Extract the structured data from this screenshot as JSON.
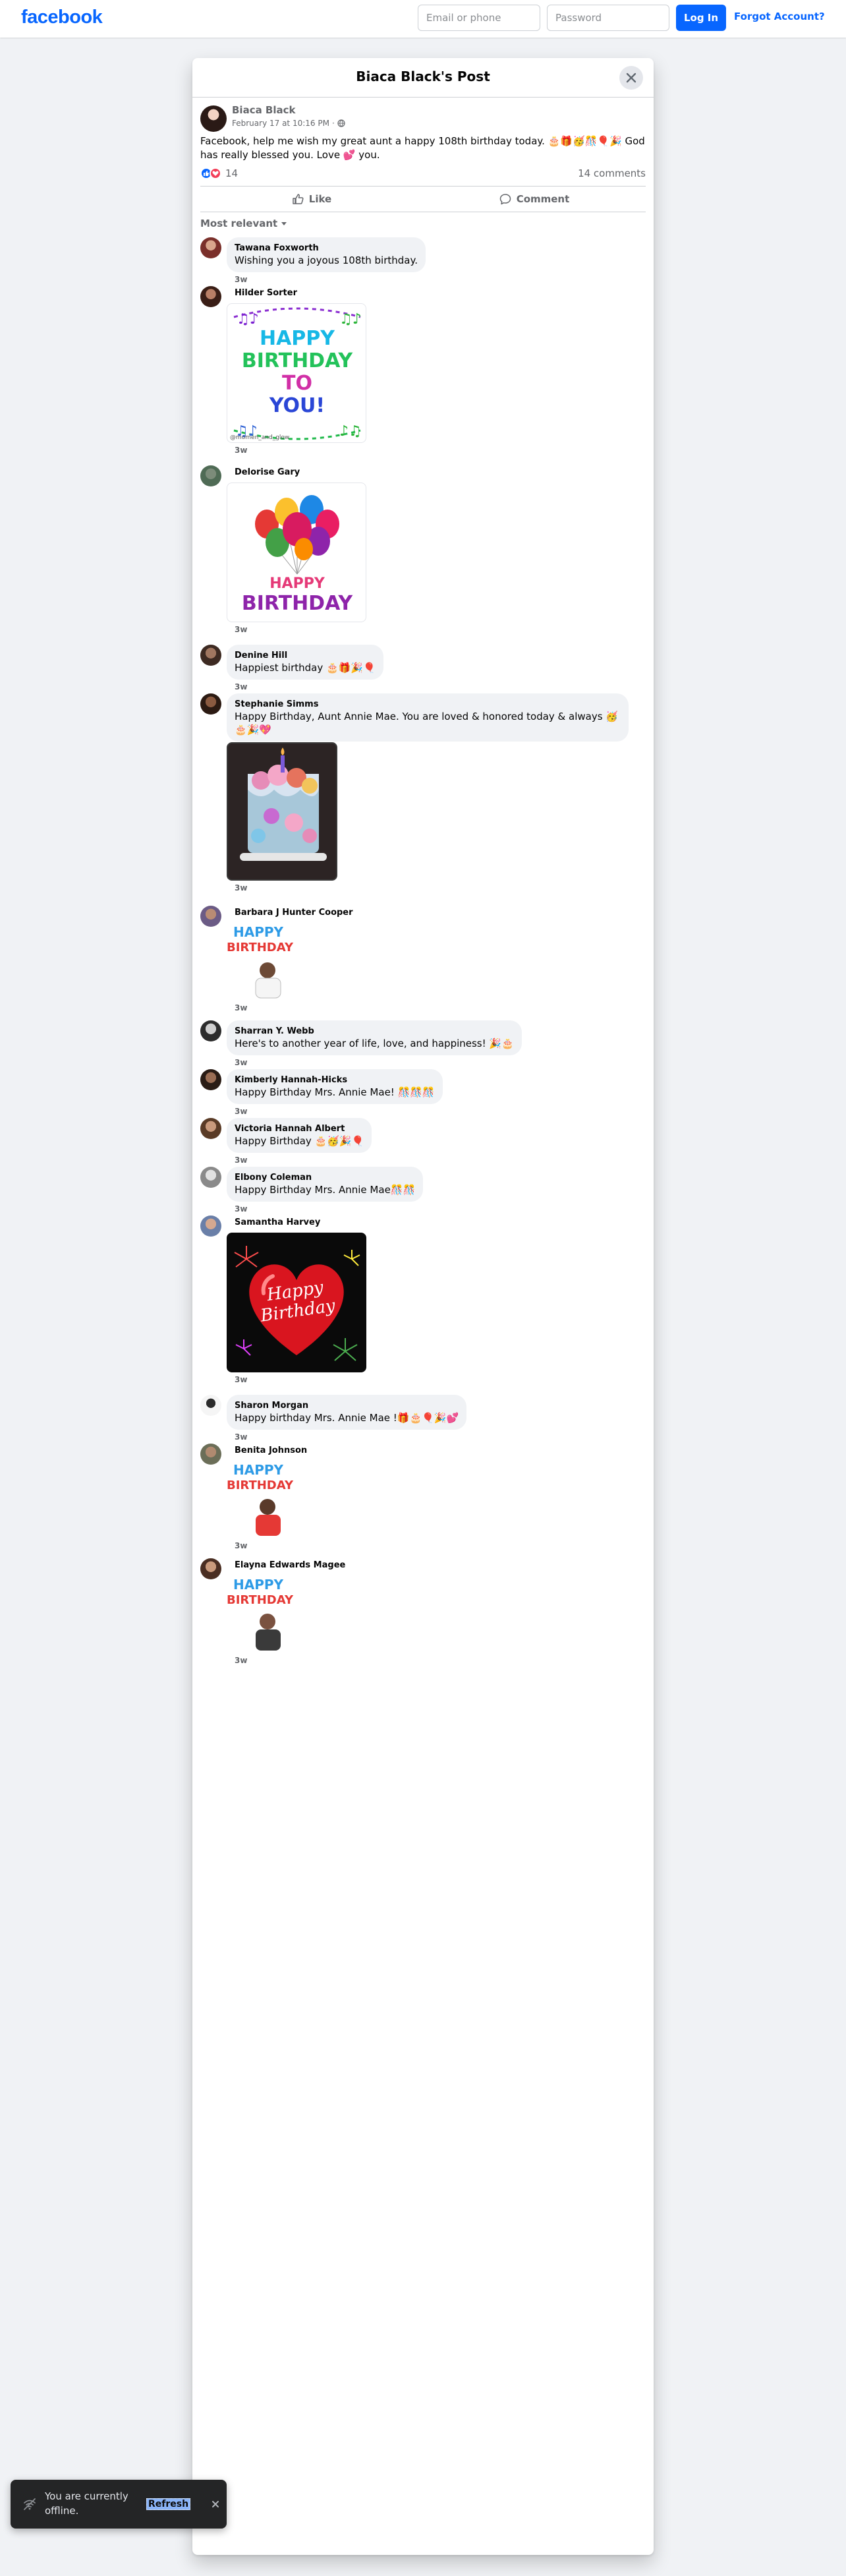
{
  "topbar": {
    "logo": "facebook",
    "email_placeholder": "Email or phone",
    "password_placeholder": "Password",
    "login_label": "Log In",
    "forgot_label": "Forgot Account?"
  },
  "dialog": {
    "title": "Biaca Black's Post",
    "post": {
      "author": "Biaca Black",
      "date": "February 17 at 10:16 PM",
      "separator": "·",
      "text": "Facebook, help me wish my great aunt a happy 108th birthday today. 🎂🎁🥳🎊🎈🎉 God has really blessed you. Love 💕 you.",
      "reaction_count": "14",
      "comments_count": "14 comments"
    },
    "actions": {
      "like": "Like",
      "comment": "Comment"
    },
    "sort_label": "Most relevant",
    "comments": [
      {
        "name": "Tawana Foxworth",
        "text": "Wishing you a joyous 108th birthday.",
        "time": "3w"
      },
      {
        "name": "Hilder Sorter",
        "time": "3w",
        "media_lines": [
          "HAPPY",
          "BIRTHDAY",
          "TO",
          "YOU!"
        ],
        "watermark": "@momen_and_glow"
      },
      {
        "name": "Delorise Gary",
        "time": "3w",
        "media_lines": [
          "HAPPY",
          "BIRTHDAY"
        ]
      },
      {
        "name": "Denine Hill",
        "text": "Happiest birthday 🎂🎁🎉🎈",
        "time": "3w"
      },
      {
        "name": "Stephanie Simms",
        "text": "Happy Birthday, Aunt Annie Mae. You are loved & honored today & always 🥳🎂🎉💖",
        "time": "3w"
      },
      {
        "name": "Barbara J Hunter Cooper",
        "time": "3w",
        "media_lines": [
          "HAPPY",
          "BIRTHDAY"
        ]
      },
      {
        "name": "Sharran Y. Webb",
        "text": "Here's to another year of life, love, and happiness! 🎉🎂",
        "time": "3w"
      },
      {
        "name": "Kimberly Hannah-Hicks",
        "text": "Happy Birthday Mrs. Annie Mae! 🎊🎊🎊",
        "time": "3w"
      },
      {
        "name": "Victoria Hannah Albert",
        "text": "Happy Birthday 🎂🥳🎉🎈",
        "time": "3w"
      },
      {
        "name": "Elbony Coleman",
        "text": "Happy Birthday Mrs. Annie Mae🎊🎊",
        "time": "3w"
      },
      {
        "name": "Samantha Harvey",
        "time": "3w",
        "media_lines": [
          "Happy",
          "Birthday"
        ]
      },
      {
        "name": "Sharon Morgan",
        "text": "Happy birthday Mrs. Annie Mae !🎁🎂🎈🎉💕",
        "time": "3w"
      },
      {
        "name": "Benita Johnson",
        "time": "3w",
        "media_lines": [
          "HAPPY",
          "BIRTHDAY"
        ]
      },
      {
        "name": "Elayna Edwards Magee",
        "time": "3w",
        "media_lines": [
          "HAPPY",
          "BIRTHDAY"
        ]
      }
    ]
  },
  "toast": {
    "text": "You are currently offline.",
    "refresh_label": "Refresh"
  },
  "colors": {
    "brand": "#0866ff",
    "bubble": "#f0f2f5",
    "muted": "#65676b"
  },
  "icons": [
    "close-icon",
    "globe-icon",
    "like-reaction-icon",
    "love-reaction-icon",
    "thumbs-up-icon",
    "comment-icon",
    "caret-down-icon",
    "wifi-off-icon"
  ]
}
